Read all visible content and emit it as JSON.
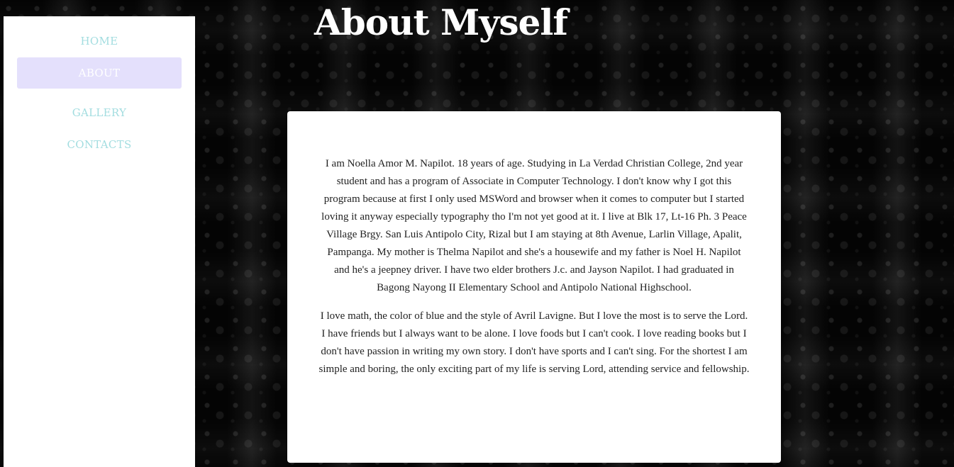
{
  "sidebar": {
    "items": [
      {
        "label": "HOME",
        "active": false
      },
      {
        "label": "ABOUT",
        "active": true
      },
      {
        "label": "GALLERY",
        "active": false
      },
      {
        "label": "CONTACTS",
        "active": false
      }
    ]
  },
  "header": {
    "title": "About Myself"
  },
  "content": {
    "paragraphs": [
      "I am Noella Amor M. Napilot. 18 years of age. Studying in La Verdad Christian College, 2nd year student and has a program of Associate in Computer Technology. I don't know why I got this program because at first I only used MSWord and browser when it comes to computer but I started loving it anyway especially typography tho I'm not yet good at it. I live at Blk 17, Lt-16 Ph. 3 Peace Village Brgy. San Luis Antipolo City, Rizal but I am staying at 8th Avenue, Larlin Village, Apalit, Pampanga. My mother is Thelma Napilot and she's a housewife and my father is Noel H. Napilot and he's a jeepney driver. I have two elder brothers J.c. and Jayson Napilot. I had graduated in Bagong Nayong II Elementary School and Antipolo National Highschool.",
      "I love math, the color of blue and the style of Avril Lavigne. But I love the most is to serve the Lord. I have friends but I always want to be alone. I love foods but I can't cook. I love reading books but I don't have passion in writing my own story. I don't have sports and I can't sing. For the shortest I am simple and boring, the only exciting part of my life is serving Lord, attending service and fellowship."
    ]
  },
  "colors": {
    "nav_text": "#a3dde0",
    "nav_active_bg": "#e4e0fc",
    "card_bg": "#ffffff",
    "title": "#ffffff"
  }
}
